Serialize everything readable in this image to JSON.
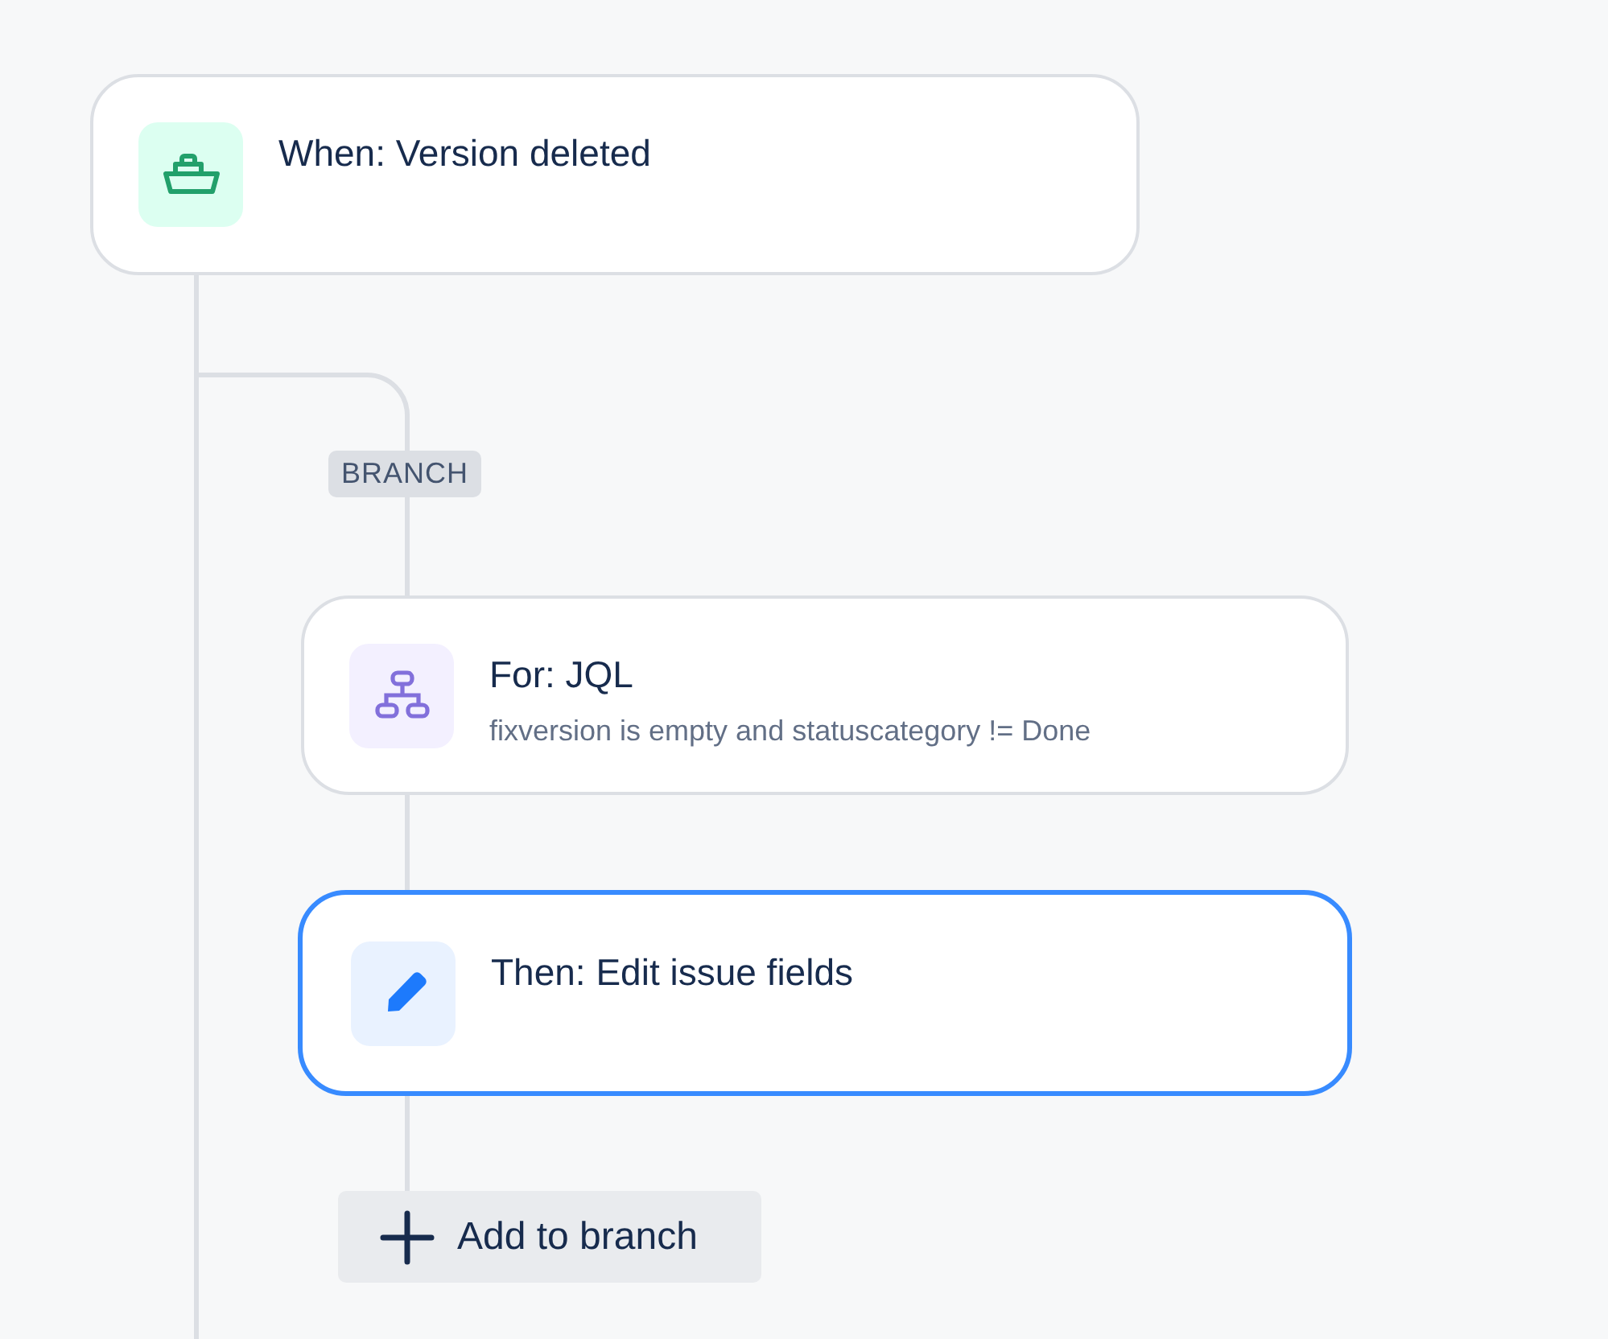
{
  "trigger": {
    "title": "When: Version deleted",
    "kind": "trigger",
    "selected": false
  },
  "branch": {
    "label": "BRANCH",
    "steps": [
      {
        "title": "For: JQL",
        "subtitle": "fixversion is empty and statuscategory != Done",
        "kind": "loop",
        "selected": false
      },
      {
        "title": "Then: Edit issue fields",
        "kind": "action",
        "selected": true
      }
    ],
    "add_button": "Add to branch"
  }
}
